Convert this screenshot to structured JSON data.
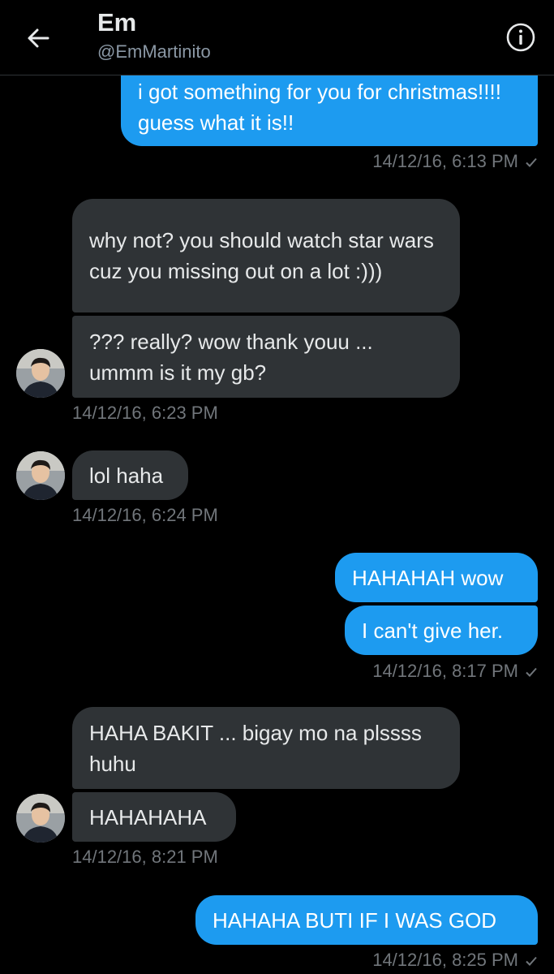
{
  "header": {
    "title": "Em",
    "handle": "@EmMartinito",
    "back_icon": "arrow-left-icon",
    "info_icon": "info-circle-icon"
  },
  "messages": [
    {
      "text": "i got something for you for christmas!!!! guess what it is!!",
      "direction": "outgoing"
    },
    {
      "text": "why not? you should watch star wars cuz you missing out on a lot :)))",
      "direction": "incoming"
    },
    {
      "text": "??? really? wow thank youu ... ummm is it my gb?",
      "direction": "incoming"
    },
    {
      "text": "lol haha",
      "direction": "incoming"
    },
    {
      "text": "HAHAHAH wow",
      "direction": "outgoing"
    },
    {
      "text": "I can't give her.",
      "direction": "outgoing"
    },
    {
      "text": "HAHA BAKIT ... bigay mo na plssss huhu",
      "direction": "incoming"
    },
    {
      "text": "HAHAHAHA",
      "direction": "incoming"
    },
    {
      "text": "HAHAHA BUTI IF I WAS GOD",
      "direction": "outgoing"
    }
  ],
  "timestamps": [
    "14/12/16, 6:13 PM",
    "14/12/16, 6:23 PM",
    "14/12/16, 6:24 PM",
    "14/12/16, 8:17 PM",
    "14/12/16, 8:21 PM",
    "14/12/16, 8:25 PM"
  ],
  "colors": {
    "outgoing_bubble": "#1d9bf0",
    "incoming_bubble": "#2f3336",
    "background": "#000000",
    "timestamp": "#71767b"
  }
}
